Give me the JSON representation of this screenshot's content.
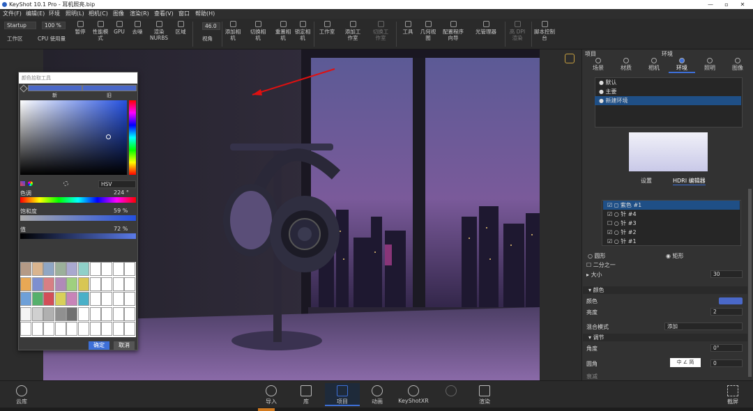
{
  "window": {
    "title": "KeyShot 10.1 Pro  -  耳机照亮.bip"
  },
  "menu": [
    "文件(F)",
    "编辑(E)",
    "环境",
    "照明(L)",
    "相机(C)",
    "图像",
    "渲染(R)",
    "查看(V)",
    "窗口",
    "帮助(H)"
  ],
  "toolbar": {
    "preset": "Startup",
    "zoom": "100 %",
    "fov": "46.0",
    "items": [
      "工作区",
      "CPU 使用量",
      "暂停",
      "性能模式",
      "GPU",
      "去噪",
      "渲染NURBS",
      "区域",
      "视角",
      "添加相机",
      "切换相机",
      "重置相机",
      "锁定相机",
      "工作室",
      "添加工作室",
      "切换工作室",
      "工具",
      "几何视图",
      "配置程序向导",
      "光管理器",
      "高 DPI 渲染",
      "脚本控制台"
    ]
  },
  "color_picker": {
    "title": "颜色拾取工具",
    "new_label": "新",
    "old_label": "旧",
    "mode": "HSV",
    "hue_label": "色调",
    "hue_value": "224 °",
    "sat_label": "饱和度",
    "sat_value": "59 %",
    "val_label": "值",
    "val_value": "72 %",
    "ok": "确定",
    "cancel": "取消",
    "current_color": "#4a68c8",
    "swatch_colors": [
      "#b49a86",
      "#d9b48e",
      "#8fa6c4",
      "#9bb09a",
      "#a9a8cf",
      "#8fd0c8",
      "#e8a855",
      "#7d8fd0",
      "#d77f84",
      "#b08ab8",
      "#9fd07f",
      "#d8c654",
      "#6ea0d8",
      "#56b06c",
      "#d24e58",
      "#d8d05a",
      "#c884b8",
      "#4ab0c8",
      "#f4f4f4",
      "#d0d0d0",
      "#b0b0b0",
      "#909090",
      "#707070",
      "#ffffff"
    ]
  },
  "right_panel": {
    "header_left": "项目",
    "header_center": "环境",
    "tabs": [
      "场景",
      "材质",
      "相机",
      "环境",
      "照明",
      "图像"
    ],
    "env_list": [
      "默认",
      "主要",
      "新建环境"
    ],
    "subtabs": [
      "设置",
      "HDRI 编辑器"
    ],
    "pins": [
      "紫色 #1",
      "针 #4",
      "针 #3",
      "针 #2",
      "针 #1"
    ],
    "shape_circle": "圆形",
    "shape_rect": "矩形",
    "half": "二分之一",
    "size_label": "大小",
    "size_value": "30",
    "color_section": "颜色",
    "color_label": "颜色",
    "brightness_label": "亮度",
    "brightness_value": "2",
    "blend_label": "混合模式",
    "blend_value": "添加",
    "adjust_section": "调节",
    "angle_label": "角度",
    "angle_value": "0°",
    "roundness_label": "圆角",
    "roundness_value": "0",
    "bottom_label": "衰减",
    "ime": "中 ∠ 简"
  },
  "bottom": {
    "items": [
      "云库",
      "导入",
      "库",
      "项目",
      "动画",
      "KeyShotXR",
      "渲染"
    ],
    "right": "截屏"
  },
  "colors": {
    "accent": "#3d6fd8",
    "panel": "#323232",
    "selected": "#1f4f86"
  }
}
